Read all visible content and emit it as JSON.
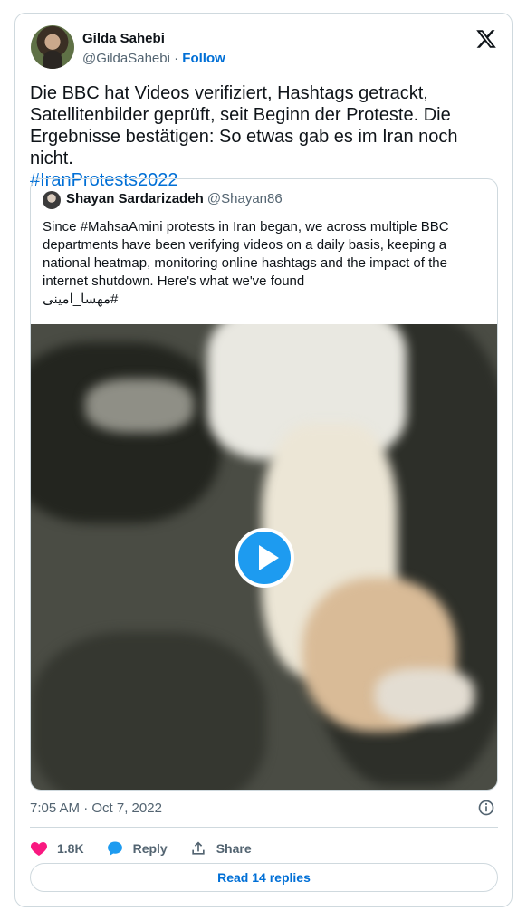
{
  "author": {
    "name": "Gilda Sahebi",
    "handle": "@GildaSahebi",
    "separator": " · ",
    "follow_label": "Follow"
  },
  "tweet": {
    "text": "Die BBC hat Videos verifiziert, Hashtags getrackt, Satellitenbilder geprüft, seit Beginn der Proteste. Die Ergebnisse bestätigen: So etwas gab es im Iran noch nicht.",
    "hashtag": "#IranProtests2022"
  },
  "quoted": {
    "name": "Shayan Sardarizadeh",
    "handle": "@Shayan86",
    "text": "Since #MahsaAmini protests in Iran began, we across multiple BBC departments have been verifying videos on a daily basis, keeping a national heatmap, monitoring online hashtags and the impact of the internet shutdown. Here's what we've found",
    "rtl_hashtag": "#مهسا_امینی"
  },
  "meta": {
    "timestamp": "7:05 AM · Oct 7, 2022"
  },
  "actions": {
    "like_count": "1.8K",
    "reply_label": "Reply",
    "share_label": "Share"
  },
  "footer": {
    "read_replies": "Read 14 replies"
  },
  "colors": {
    "link": "#006fd6",
    "like": "#f91880",
    "reply": "#1d9bf0",
    "play": "#1d9bf0"
  },
  "icons": [
    "x-logo-icon",
    "play-icon",
    "info-icon",
    "heart-icon",
    "reply-bubble-icon",
    "share-icon"
  ]
}
